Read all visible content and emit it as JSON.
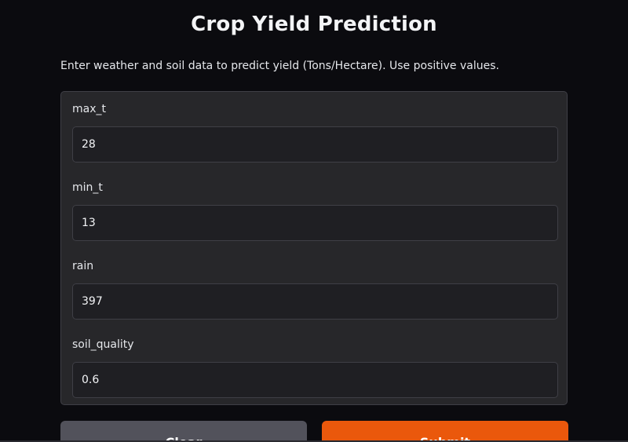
{
  "header": {
    "title": "Crop Yield Prediction",
    "description": "Enter weather and soil data to predict yield (Tons/Hectare). Use positive values."
  },
  "form": {
    "fields": [
      {
        "label": "max_t",
        "value": "28"
      },
      {
        "label": "min_t",
        "value": "13"
      },
      {
        "label": "rain",
        "value": "397"
      },
      {
        "label": "soil_quality",
        "value": "0.6"
      }
    ]
  },
  "actions": {
    "clear_label": "Clear",
    "submit_label": "Submit"
  },
  "colors": {
    "background": "#0b0b0f",
    "panel": "#27272a",
    "submit": "#ea580c",
    "clear": "#52525b"
  }
}
